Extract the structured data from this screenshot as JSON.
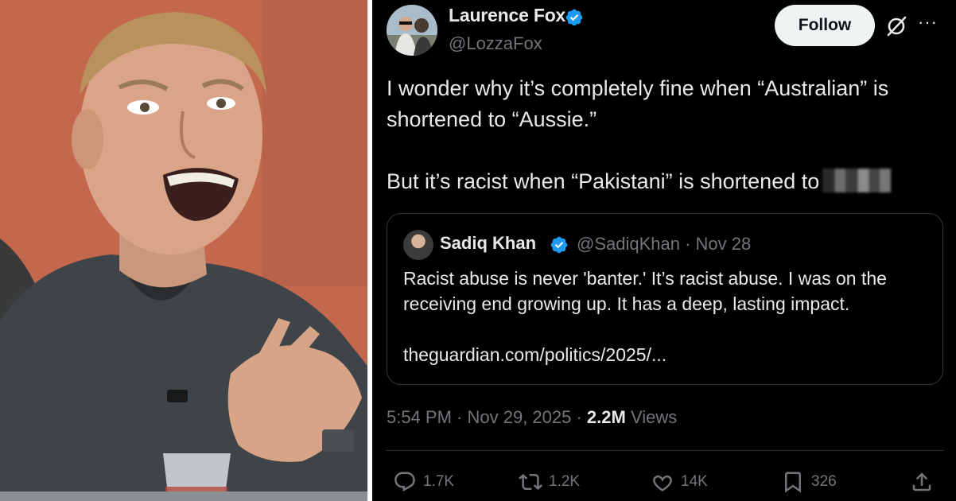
{
  "author": {
    "display_name": "Laurence Fox",
    "handle": "@LozzaFox",
    "verified": true
  },
  "follow_label": "Follow",
  "more_label": "···",
  "tweet": {
    "line1": "I wonder why it’s completely fine when “Australian” is shortened to “Aussie.”",
    "line2": "But it’s racist when “Pakistani” is shortened to"
  },
  "quoted": {
    "display_name": "Sadiq Khan",
    "handle_time": "@SadiqKhan · Nov 28",
    "text": "Racist abuse is never 'banter.' It’s racist abuse. I was on the receiving end growing up. It has a deep, lasting impact.\n\ntheguardian.com/politics/2025/..."
  },
  "meta": {
    "time_date": "5:54 PM · Nov 29, 2025 · ",
    "views_count": "2.2M",
    "views_label": " Views"
  },
  "actions": {
    "replies": "1.7K",
    "reposts": "1.2K",
    "likes": "14K",
    "bookmarks": "326"
  },
  "colors": {
    "background": "#000000",
    "text": "#e7e9ea",
    "muted": "#71767b",
    "verified_blue": "#1d9bf0",
    "border": "#2f3336"
  }
}
